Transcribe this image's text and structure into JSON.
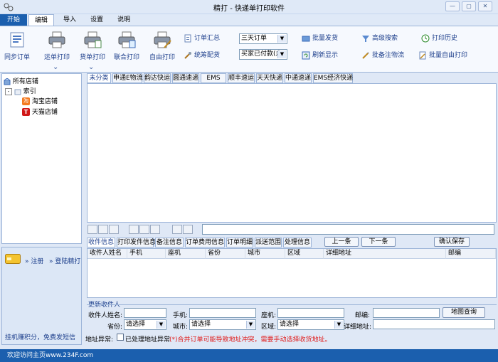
{
  "app": {
    "title": "精打 - 快递单打印软件"
  },
  "window_controls": {
    "minimize": "—",
    "restore": "▢",
    "close": "✕"
  },
  "menu": {
    "tabs": [
      "开始",
      "编辑",
      "导入",
      "设置",
      "说明"
    ]
  },
  "ribbon": {
    "sync_orders": "同步订单",
    "waybill_print": "运单打印",
    "goods_print": "货单打印",
    "combined_print": "联合打印",
    "free_print": "自由打印",
    "order_summary": "订单汇总",
    "pick_stats": "统筹配货",
    "range_select": "三天订单",
    "status_select": "买家已付款(未",
    "batch_ship": "批量发货",
    "refresh_display": "刷新显示",
    "advanced_search": "高级搜索",
    "batch_note_logistics": "批备注物流",
    "print_history": "打印历史",
    "batch_free_print": "批量自由打印"
  },
  "left_panel": {
    "root": "所有店铺",
    "group": "索引",
    "shops": [
      {
        "label": "淘宝店铺",
        "badge": "淘"
      },
      {
        "label": "天猫店铺",
        "badge": "T"
      }
    ]
  },
  "left_bottom": {
    "register": "注册",
    "login": "登陆精打",
    "promo": "挂机赚积分，免费发短信"
  },
  "courier_tabs": [
    "未分类",
    "申通E物流",
    "韵达快运",
    "圆通速递",
    "EMS",
    "顺丰速运",
    "天天快递",
    "中通速递",
    "EMS经济快递"
  ],
  "detail_tabs": [
    "收件信息",
    "打印发件信息",
    "备注信息",
    "订单费用信息",
    "订单明细",
    "派送范围",
    "处理信息"
  ],
  "nav": {
    "prev": "上一条",
    "next": "下一条",
    "confirm": "确认保存"
  },
  "detail_columns": [
    "收件人姓名",
    "手机",
    "座机",
    "省份",
    "城市",
    "区域",
    "详细地址",
    "邮编"
  ],
  "receiver_form": {
    "section_title": "更新收件人",
    "name_label": "收件人姓名:",
    "mobile_label": "手机:",
    "phone_label": "座机:",
    "zip_label": "邮编:",
    "map_button": "地图查询",
    "province_label": "省份:",
    "province_value": "请选择",
    "city_label": "城市:",
    "city_value": "请选择",
    "district_label": "区域:",
    "district_value": "请选择",
    "address_label": "详细地址:",
    "abnormal_label": "地址异常:",
    "abnormal_check": "已处理地址异常",
    "warning": "(*)合并订单可能导致地址冲突，需要手动选择收货地址。"
  },
  "status": {
    "text": "欢迎访问主页www.234F.com"
  },
  "colors": {
    "brand": "#1b5fae",
    "warning": "#e02020",
    "accent_text": "#1d3f8c"
  }
}
